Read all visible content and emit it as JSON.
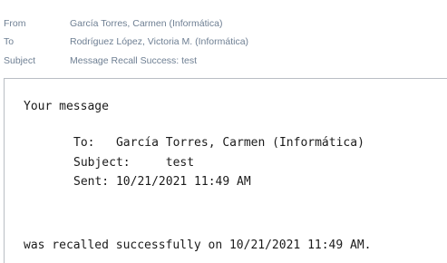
{
  "header": {
    "from_label": "From",
    "from_value": "García Torres, Carmen (Informática)",
    "to_label": "To",
    "to_value": "Rodríguez López, Victoria M. (Informática)",
    "subject_label": "Subject",
    "subject_value": "Message Recall Success: test"
  },
  "body": {
    "intro": "Your message",
    "to_line": "To:   García Torres, Carmen (Informática)",
    "subject_line": "Subject:     test",
    "sent_line": "Sent: 10/21/2021 11:49 AM",
    "outro": "was recalled successfully on 10/21/2021 11:49 AM."
  }
}
